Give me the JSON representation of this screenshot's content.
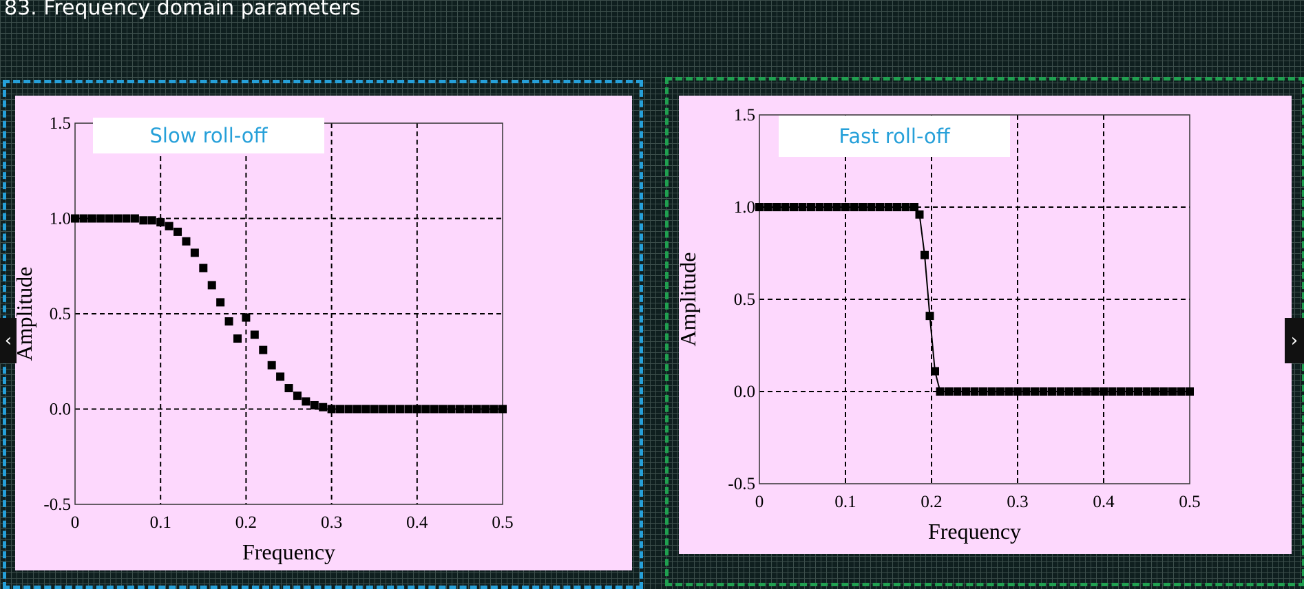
{
  "slide": {
    "title": "83. Frequency domain parameters"
  },
  "nav": {
    "prev_icon": "‹",
    "next_icon": "›"
  },
  "chart_data": [
    {
      "type": "scatter",
      "annotation": "Slow roll-off",
      "annotation_color": "#26a0d9",
      "xlabel": "Frequency",
      "ylabel": "Amplitude",
      "xlim": [
        0,
        0.5
      ],
      "ylim": [
        -0.5,
        1.5
      ],
      "xticks": [
        "0",
        "0.1",
        "0.2",
        "0.3",
        "0.4",
        "0.5"
      ],
      "yticks": [
        "1.5",
        "1.0",
        "0.5",
        "0.0",
        "-0.5"
      ],
      "grid": true,
      "connect_points": false,
      "series": [
        {
          "x": [
            0.0,
            0.01,
            0.02,
            0.03,
            0.04,
            0.05,
            0.06,
            0.07,
            0.08,
            0.09,
            0.1,
            0.11,
            0.12,
            0.13,
            0.14,
            0.15,
            0.16,
            0.17,
            0.18,
            0.19,
            0.2,
            0.21,
            0.22,
            0.23,
            0.24,
            0.25,
            0.26,
            0.27,
            0.28,
            0.29,
            0.3,
            0.31,
            0.32,
            0.33,
            0.34,
            0.35,
            0.36,
            0.37,
            0.38,
            0.39,
            0.4,
            0.41,
            0.42,
            0.43,
            0.44,
            0.45,
            0.46,
            0.47,
            0.48,
            0.49,
            0.5
          ],
          "y": [
            1.0,
            1.0,
            1.0,
            1.0,
            1.0,
            1.0,
            1.0,
            1.0,
            0.99,
            0.99,
            0.98,
            0.96,
            0.93,
            0.88,
            0.82,
            0.74,
            0.65,
            0.56,
            0.46,
            0.37,
            0.48,
            0.39,
            0.31,
            0.23,
            0.17,
            0.11,
            0.07,
            0.04,
            0.02,
            0.01,
            0.0,
            0.0,
            0.0,
            0.0,
            0.0,
            0.0,
            0.0,
            0.0,
            0.0,
            0.0,
            0.0,
            0.0,
            0.0,
            0.0,
            0.0,
            0.0,
            0.0,
            0.0,
            0.0,
            0.0,
            0.0
          ]
        }
      ]
    },
    {
      "type": "line",
      "annotation": "Fast roll-off",
      "annotation_color": "#26a0d9",
      "xlabel": "Frequency",
      "ylabel": "Amplitude",
      "xlim": [
        0,
        0.5
      ],
      "ylim": [
        -0.5,
        1.5
      ],
      "xticks": [
        "0",
        "0.1",
        "0.2",
        "0.3",
        "0.4",
        "0.5"
      ],
      "yticks": [
        "1.5",
        "1.0",
        "0.5",
        "0.0",
        "-0.5"
      ],
      "grid": true,
      "connect_points": true,
      "series": [
        {
          "x": [
            0.0,
            0.01,
            0.02,
            0.03,
            0.04,
            0.05,
            0.06,
            0.07,
            0.08,
            0.09,
            0.1,
            0.11,
            0.12,
            0.13,
            0.14,
            0.15,
            0.16,
            0.17,
            0.18,
            0.186,
            0.192,
            0.198,
            0.204,
            0.21,
            0.22,
            0.23,
            0.24,
            0.25,
            0.26,
            0.27,
            0.28,
            0.29,
            0.3,
            0.31,
            0.32,
            0.33,
            0.34,
            0.35,
            0.36,
            0.37,
            0.38,
            0.39,
            0.4,
            0.41,
            0.42,
            0.43,
            0.44,
            0.45,
            0.46,
            0.47,
            0.48,
            0.49,
            0.5
          ],
          "y": [
            1.0,
            1.0,
            1.0,
            1.0,
            1.0,
            1.0,
            1.0,
            1.0,
            1.0,
            1.0,
            1.0,
            1.0,
            1.0,
            1.0,
            1.0,
            1.0,
            1.0,
            1.0,
            1.0,
            0.96,
            0.74,
            0.41,
            0.11,
            0.0,
            0.0,
            0.0,
            0.0,
            0.0,
            0.0,
            0.0,
            0.0,
            0.0,
            0.0,
            0.0,
            0.0,
            0.0,
            0.0,
            0.0,
            0.0,
            0.0,
            0.0,
            0.0,
            0.0,
            0.0,
            0.0,
            0.0,
            0.0,
            0.0,
            0.0,
            0.0,
            0.0,
            0.0,
            0.0
          ]
        }
      ]
    }
  ]
}
